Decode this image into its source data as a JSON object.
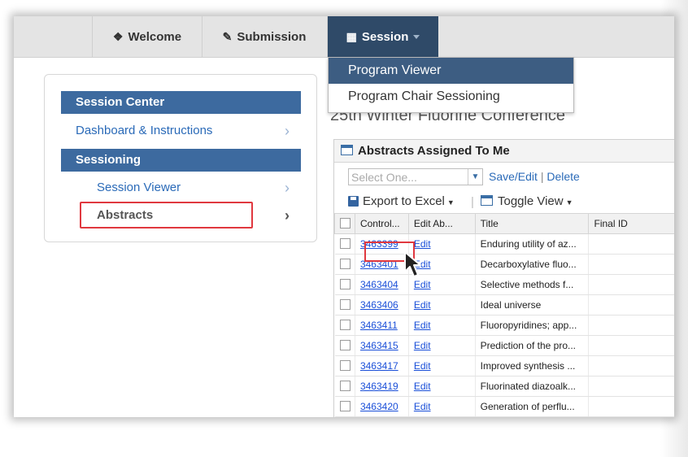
{
  "nav": {
    "welcome": "Welcome",
    "submission": "Submission",
    "session": "Session"
  },
  "dropdown": {
    "items": [
      "Program Viewer",
      "Program Chair Sessioning"
    ]
  },
  "sidebar": {
    "session_center": "Session Center",
    "dashboard": "Dashboard & Instructions",
    "sessioning": "Sessioning",
    "session_viewer": "Session Viewer",
    "abstracts": "Abstracts"
  },
  "conference_title": "25th Winter Fluorine Conference",
  "abstracts_panel": {
    "title": "Abstracts Assigned To Me",
    "select_placeholder": "Select One...",
    "save_edit": "Save/Edit",
    "delete": "Delete",
    "export": "Export to Excel",
    "toggle_view": "Toggle View",
    "columns": [
      "Control...",
      "Edit Ab...",
      "Title",
      "Final ID"
    ],
    "rows": [
      {
        "control": "3463399",
        "edit": "Edit",
        "title": "Enduring utility of az..."
      },
      {
        "control": "3463401",
        "edit": "Edit",
        "title": "Decarboxylative fluo..."
      },
      {
        "control": "3463404",
        "edit": "Edit",
        "title": "Selective methods f..."
      },
      {
        "control": "3463406",
        "edit": "Edit",
        "title": "Ideal universe"
      },
      {
        "control": "3463411",
        "edit": "Edit",
        "title": "Fluoropyridines; app..."
      },
      {
        "control": "3463415",
        "edit": "Edit",
        "title": "Prediction of the pro..."
      },
      {
        "control": "3463417",
        "edit": "Edit",
        "title": "Improved synthesis ..."
      },
      {
        "control": "3463419",
        "edit": "Edit",
        "title": "Fluorinated diazoalk..."
      },
      {
        "control": "3463420",
        "edit": "Edit",
        "title": "Generation of perflu..."
      }
    ]
  },
  "colors": {
    "nav_active": "#2f4a68",
    "sidebar_header": "#3d6a9f",
    "highlight": "#e0383f",
    "link": "#2a6ab8"
  }
}
